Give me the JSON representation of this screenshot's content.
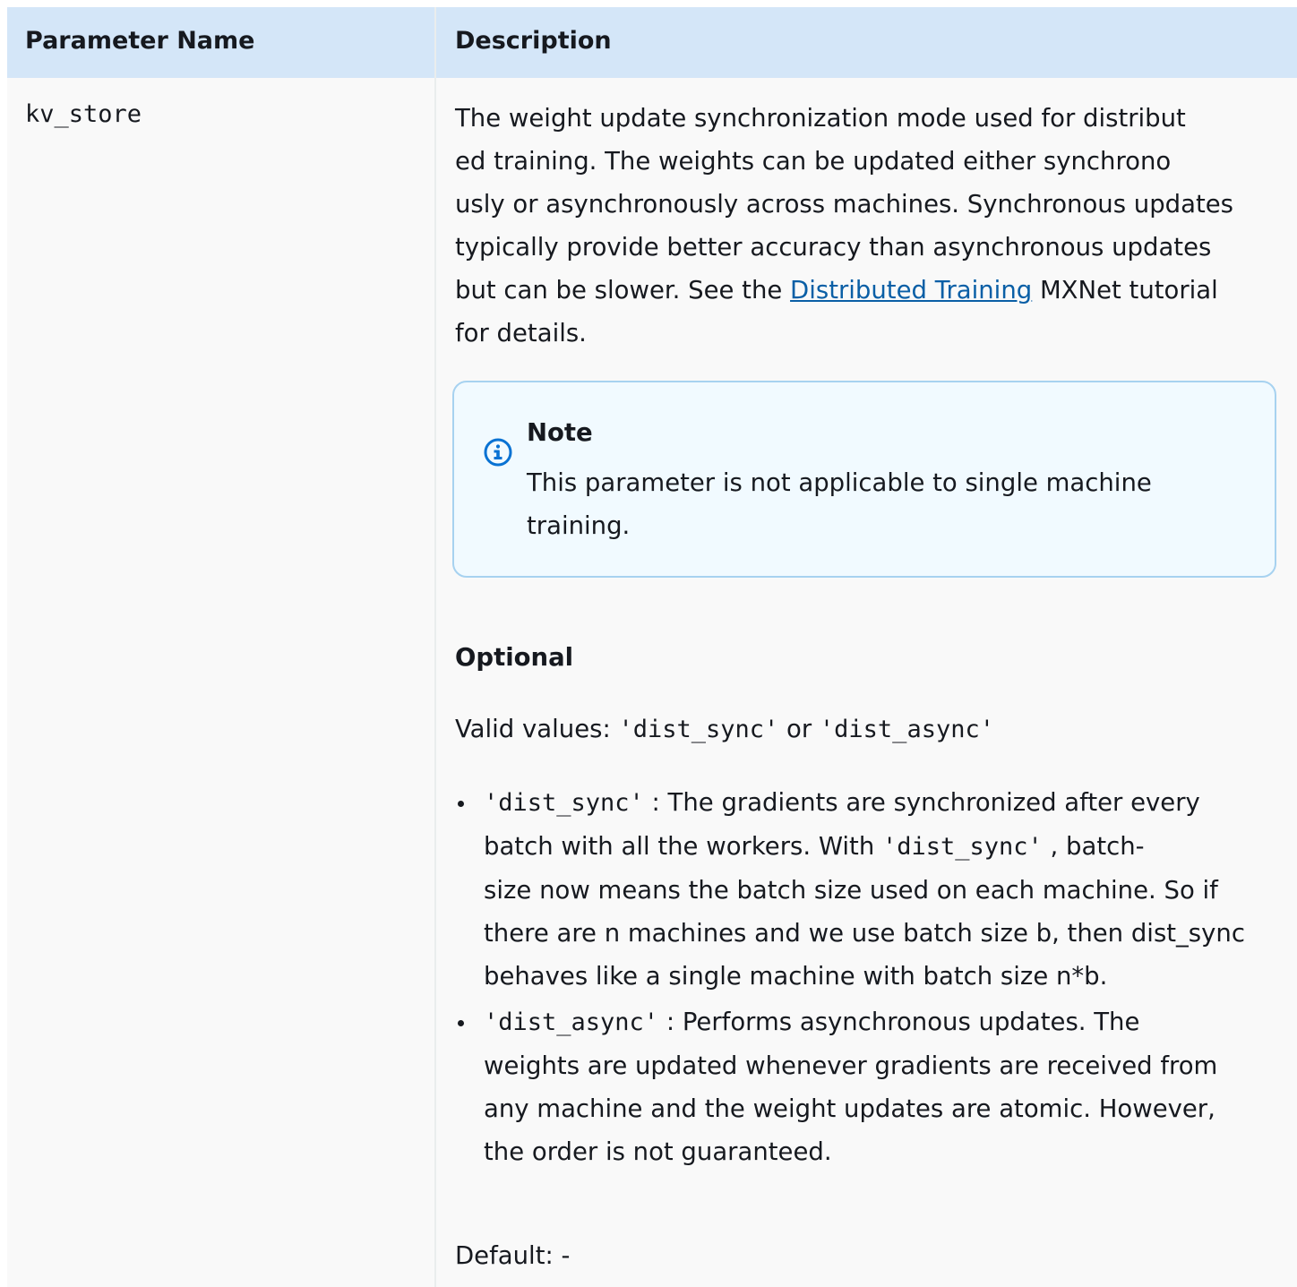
{
  "table": {
    "headers": {
      "param": "Parameter Name",
      "desc": "Description"
    },
    "row": {
      "param_name": "kv_store",
      "description": {
        "lines": [
          "The weight update synchronization mode used for distribut",
          "ed training. The weights can be updated either synchrono",
          "usly or asynchronously across machines. Synchronous updates",
          "typically provide better accuracy than asynchronous updates",
          "but can be slower. See the "
        ],
        "link_text": "Distributed Training",
        "after_link": " MXNet tutorial",
        "last_line": "for details."
      },
      "note": {
        "icon": "info-icon",
        "title": "Note",
        "body_lines": [
          "This parameter is not applicable to single machine",
          "training."
        ]
      },
      "optional_label": "Optional",
      "valid_values": {
        "prefix": "Valid values: ",
        "value1": "'dist_sync'",
        "middle": " or ",
        "value2": "'dist_async'"
      },
      "bullets": [
        {
          "code": "'dist_sync'",
          "text1": " : The gradients are synchronized after every",
          "text2": "batch with all the workers. With ",
          "code2": "'dist_sync'",
          "text3": " , batch-",
          "text4": "size now means the batch size used on each machine. So if",
          "text5": "there are n machines and we use batch size b, then dist_sync",
          "text6": "behaves like a single machine with batch size n*b."
        },
        {
          "code": "'dist_async'",
          "text1": " : Performs asynchronous updates. The",
          "text2": "weights are updated whenever gradients are received from",
          "text3": "any machine and the weight updates are atomic. However,",
          "text4": "the order is not guaranteed."
        }
      ],
      "default": "Default: -"
    }
  },
  "colors": {
    "header_bg": "#d4e6f8",
    "row_bg": "#f9f9f9",
    "note_bg": "#f1faff",
    "note_border": "#a7d2f0",
    "link": "#0a5fa6",
    "icon": "#0972d3"
  }
}
